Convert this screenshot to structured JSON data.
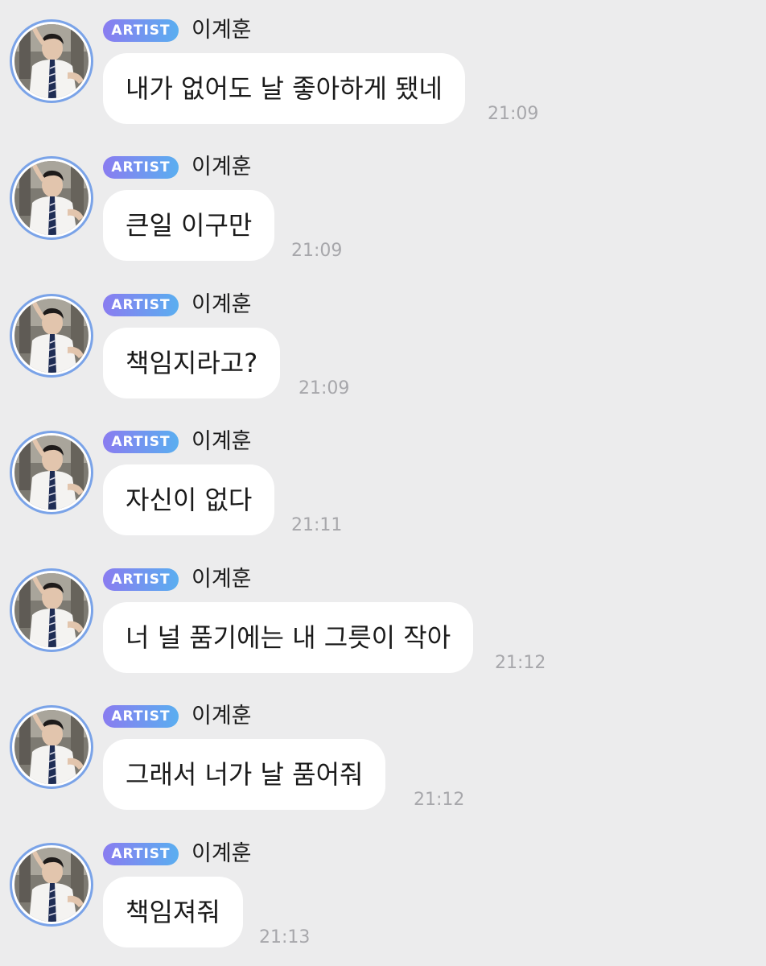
{
  "sender": {
    "badge": "ARTIST",
    "name": "이계훈"
  },
  "messages": [
    {
      "text": "내가 없어도 날 좋아하게 됐네",
      "time": "21:09"
    },
    {
      "text": "큰일 이구만",
      "time": "21:09"
    },
    {
      "text": "책임지라고?",
      "time": "21:09"
    },
    {
      "text": "자신이 없다",
      "time": "21:11"
    },
    {
      "text": "너 널 품기에는 내 그릇이 작아",
      "time": "21:12"
    },
    {
      "text": "그래서 너가 날 품어줘",
      "time": "21:12"
    },
    {
      "text": "책임져줘",
      "time": "21:13"
    }
  ],
  "colors": {
    "background": "#ececed",
    "bubble": "#ffffff",
    "badge_gradient_start": "#8a7cf0",
    "badge_gradient_end": "#5aaef0",
    "avatar_ring": "#7aa3e8",
    "timestamp": "#a7a7ab"
  }
}
